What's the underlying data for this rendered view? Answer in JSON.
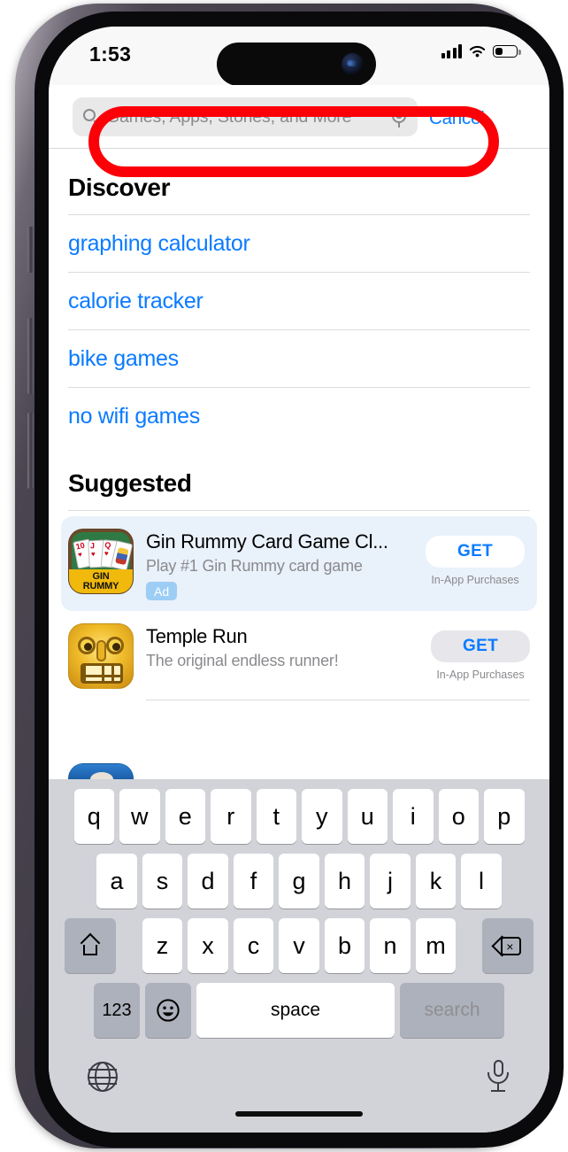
{
  "device": {
    "name": "iphone-14-pro",
    "frame_color": "#3b3742"
  },
  "status_bar": {
    "time": "1:53",
    "cellular": "signal-bars-icon",
    "wifi": "wifi-icon",
    "battery": "battery-icon",
    "battery_level_pct": 34
  },
  "search": {
    "placeholder": "Games, Apps, Stories, and More",
    "value": "",
    "search_icon": "search-icon",
    "mic_icon": "microphone-icon",
    "cancel_label": "Cancel"
  },
  "annotation": {
    "type": "highlight-ring",
    "color": "#fb0007",
    "target": "search-field"
  },
  "discover": {
    "title": "Discover",
    "items": [
      {
        "label": "graphing calculator"
      },
      {
        "label": "calorie tracker"
      },
      {
        "label": "bike games"
      },
      {
        "label": "no wifi games"
      }
    ]
  },
  "suggested": {
    "title": "Suggested",
    "apps": [
      {
        "name": "Gin Rummy Card Game Cl...",
        "subtitle": "Play #1 Gin Rummy card game",
        "badge": "Ad",
        "action_label": "GET",
        "iap_label": "In-App Purchases",
        "icon": "gin-rummy-app-icon",
        "is_ad": true
      },
      {
        "name": "Temple Run",
        "subtitle": "The original endless runner!",
        "badge": "",
        "action_label": "GET",
        "iap_label": "In-App Purchases",
        "icon": "temple-run-app-icon",
        "is_ad": false
      }
    ]
  },
  "keyboard": {
    "row1": [
      "q",
      "w",
      "e",
      "r",
      "t",
      "y",
      "u",
      "i",
      "o",
      "p"
    ],
    "row2": [
      "a",
      "s",
      "d",
      "f",
      "g",
      "h",
      "j",
      "k",
      "l"
    ],
    "row3": [
      "z",
      "x",
      "c",
      "v",
      "b",
      "n",
      "m"
    ],
    "shift_icon": "shift-icon",
    "delete_icon": "delete-icon",
    "numbers_label": "123",
    "emoji_icon": "emoji-icon",
    "space_label": "space",
    "return_label": "search",
    "globe_icon": "globe-icon",
    "dictation_icon": "microphone-icon"
  },
  "colors": {
    "accent_blue": "#0a7bff",
    "annotation_red": "#fb0007",
    "ad_row_bg": "#e9f1fb",
    "keyboard_bg": "#d1d3d9"
  }
}
